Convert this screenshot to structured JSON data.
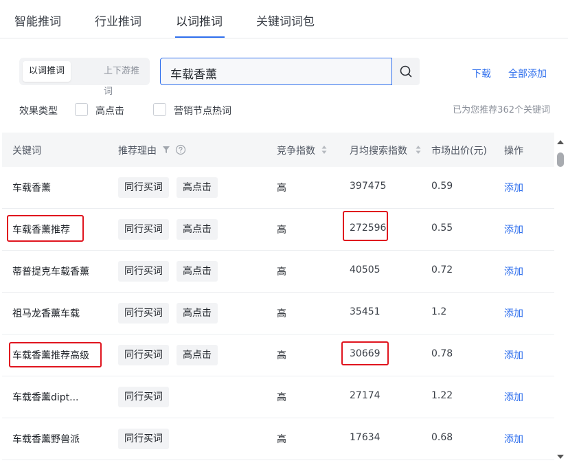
{
  "tabs": [
    "智能推词",
    "行业推词",
    "以词推词",
    "关键词词包"
  ],
  "mode_switch": {
    "active": "以词推词",
    "inactive": "上下游推词"
  },
  "search": {
    "value": "车载香薰"
  },
  "actions": {
    "download": "下载",
    "add_all": "全部添加"
  },
  "filters": {
    "label": "效果类型",
    "options": [
      "高点击",
      "营销节点热词"
    ]
  },
  "recommend_text": "已为您推荐362个关键词",
  "table": {
    "columns": [
      "关键词",
      "推荐理由",
      "竞争指数",
      "月均搜索指数",
      "市场出价(元)",
      "操作"
    ],
    "rows": [
      {
        "keyword": "车载香薰",
        "tags": [
          "同行买词",
          "高点击"
        ],
        "competition": "高",
        "search_index": "397475",
        "bid": "0.59",
        "action": "添加"
      },
      {
        "keyword": "车载香薰推荐",
        "tags": [
          "同行买词",
          "高点击"
        ],
        "competition": "高",
        "search_index": "272596",
        "bid": "0.55",
        "action": "添加"
      },
      {
        "keyword": "蒂普提克车载香薰",
        "tags": [
          "同行买词",
          "高点击"
        ],
        "competition": "高",
        "search_index": "40505",
        "bid": "0.72",
        "action": "添加"
      },
      {
        "keyword": "祖马龙香薰车载",
        "tags": [
          "同行买词",
          "高点击"
        ],
        "competition": "高",
        "search_index": "35451",
        "bid": "1.2",
        "action": "添加"
      },
      {
        "keyword": "车载香薰推荐高级",
        "tags": [
          "同行买词",
          "高点击"
        ],
        "competition": "高",
        "search_index": "30669",
        "bid": "0.78",
        "action": "添加"
      },
      {
        "keyword": "车载香薰dipt...",
        "tags": [
          "同行买词"
        ],
        "competition": "高",
        "search_index": "27174",
        "bid": "1.22",
        "action": "添加"
      },
      {
        "keyword": "车载香薰野兽派",
        "tags": [
          "同行买词"
        ],
        "competition": "高",
        "search_index": "17634",
        "bid": "0.68",
        "action": "添加"
      }
    ]
  },
  "colors": {
    "accent": "#2f6fed",
    "highlight": "#e0141e"
  },
  "icons": [
    "search-icon",
    "filter-icon",
    "help-icon",
    "sort-icon"
  ]
}
